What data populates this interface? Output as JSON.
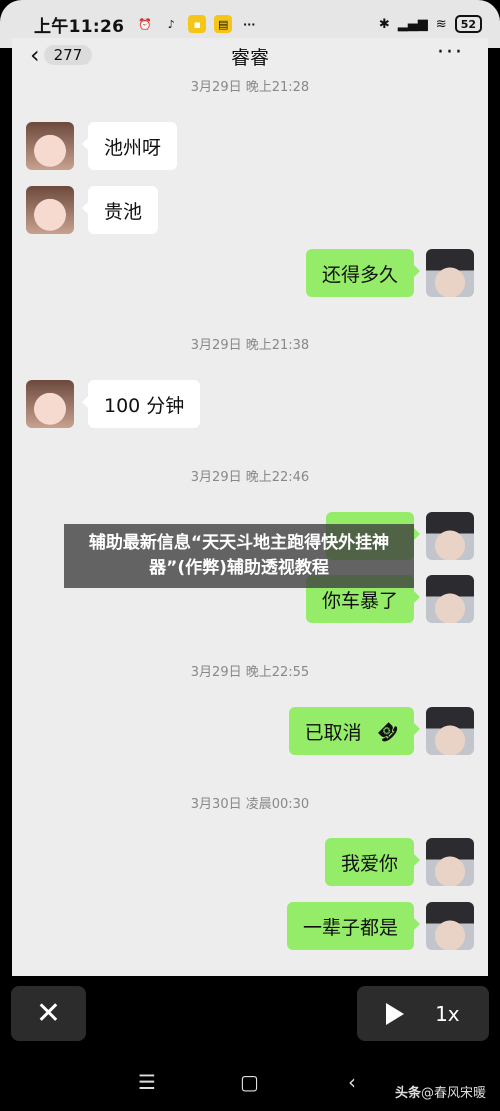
{
  "status": {
    "time": "上午11:26",
    "battery": "52"
  },
  "chat": {
    "back_count": "277",
    "title": "睿睿",
    "timestamps": [
      "3月29日 晚上21:28",
      "3月29日 晚上21:38",
      "3月29日 晚上22:46",
      "3月29日 晚上22:55",
      "3月30日 凌晨00:30"
    ],
    "messages": [
      {
        "side": "left",
        "text": "池州呀"
      },
      {
        "side": "left",
        "text": "贵池"
      },
      {
        "side": "right",
        "text": "还得多久"
      },
      {
        "side": "left",
        "text": "100 分钟"
      },
      {
        "side": "right",
        "text": "你车暴了"
      },
      {
        "side": "right",
        "text": "已取消"
      },
      {
        "side": "right",
        "text": "我爱你"
      },
      {
        "side": "right",
        "text": "一辈子都是"
      }
    ]
  },
  "overlay": {
    "headline": "辅助最新信息“天天斗地主跑得快外挂神器”(作弊)辅助透视教程"
  },
  "controls": {
    "speed": "1x"
  },
  "watermark": {
    "brand": "头条",
    "author": "@春风宋暖"
  }
}
